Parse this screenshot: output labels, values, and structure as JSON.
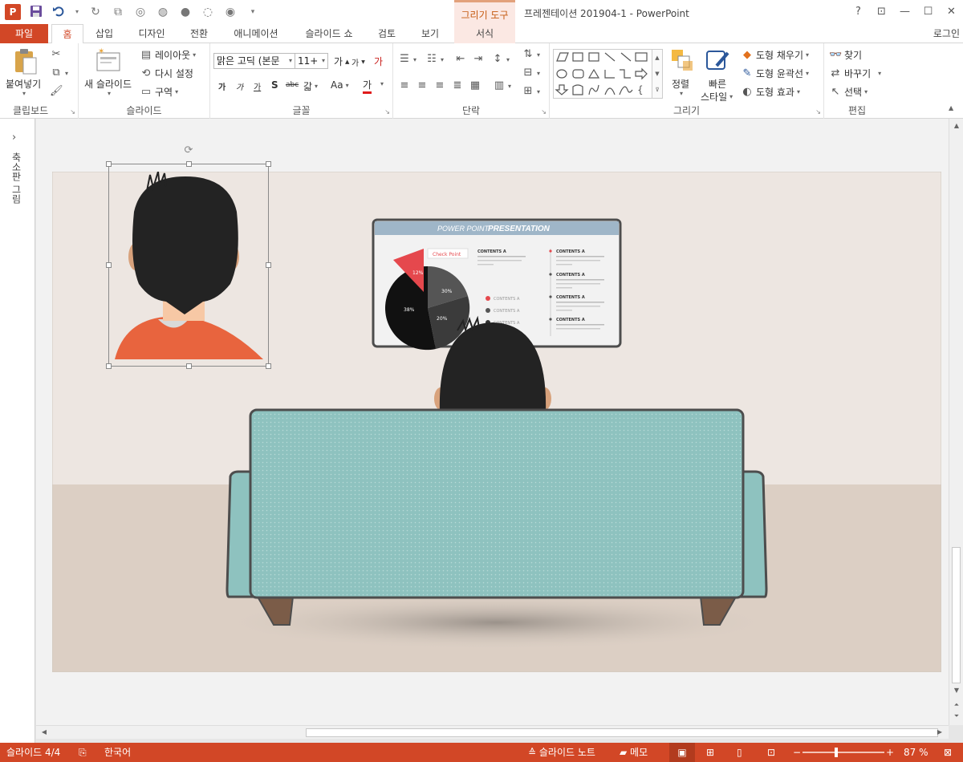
{
  "window": {
    "title": "프레젠테이션 201904-1 - PowerPoint",
    "contextual_tab_header": "그리기 도구",
    "help": "?",
    "app_logo": "P"
  },
  "tabs": [
    {
      "label": "파일"
    },
    {
      "label": "홈"
    },
    {
      "label": "삽입"
    },
    {
      "label": "디자인"
    },
    {
      "label": "전환"
    },
    {
      "label": "애니메이션"
    },
    {
      "label": "슬라이드 쇼"
    },
    {
      "label": "검토"
    },
    {
      "label": "보기"
    },
    {
      "label": "서식"
    }
  ],
  "login": "로그인",
  "ribbon": {
    "clipboard": {
      "label": "클립보드",
      "paste": "붙여넣기"
    },
    "slides": {
      "label": "슬라이드",
      "new_slide": "새 슬라이드",
      "layout": "레이아웃",
      "reset": "다시 설정",
      "section": "구역"
    },
    "font": {
      "label": "글꼴",
      "font_name": "맑은 고딕 (본문",
      "font_size": "11+",
      "grow": "가",
      "shrink": "가",
      "bold": "가",
      "italic": "가",
      "underline": "가",
      "shadow": "S",
      "strike": "abc",
      "spacing": "갋",
      "case": "Aa",
      "color": "가",
      "clear": "가"
    },
    "paragraph": {
      "label": "단락"
    },
    "drawing": {
      "label": "그리기",
      "arrange": "정렬",
      "quick_styles_1": "빠른",
      "quick_styles_2": "스타일",
      "fill": "도형 채우기",
      "outline": "도형 윤곽선",
      "effects": "도형 효과"
    },
    "editing": {
      "label": "편집",
      "find": "찾기",
      "replace": "바꾸기",
      "select": "선택"
    }
  },
  "thumbnail_pane": {
    "label": "축소판 그림"
  },
  "slide_content": {
    "screen_title_plain": "POWER POINT",
    "screen_title_bold": "PRESENTATION",
    "callout": "Check Point",
    "pie_labels": [
      "12%",
      "30%",
      "38%",
      "20%"
    ],
    "legend": [
      "CONTENTS A",
      "CONTENTS A",
      "CONTENTS A"
    ],
    "contents": [
      "CONTENTS A",
      "CONTENTS A",
      "CONTENTS A",
      "CONTENTS A",
      "CONTENTS A"
    ]
  },
  "status": {
    "slide_counter": "슬라이드 4/4",
    "language": "한국어",
    "notes": "슬라이드 노트",
    "comments": "메모",
    "zoom": "87 %"
  },
  "colors": {
    "accent": "#d24726",
    "sofa": "#8ec2bf",
    "shirt": "#e8643e",
    "hair": "#232323"
  }
}
